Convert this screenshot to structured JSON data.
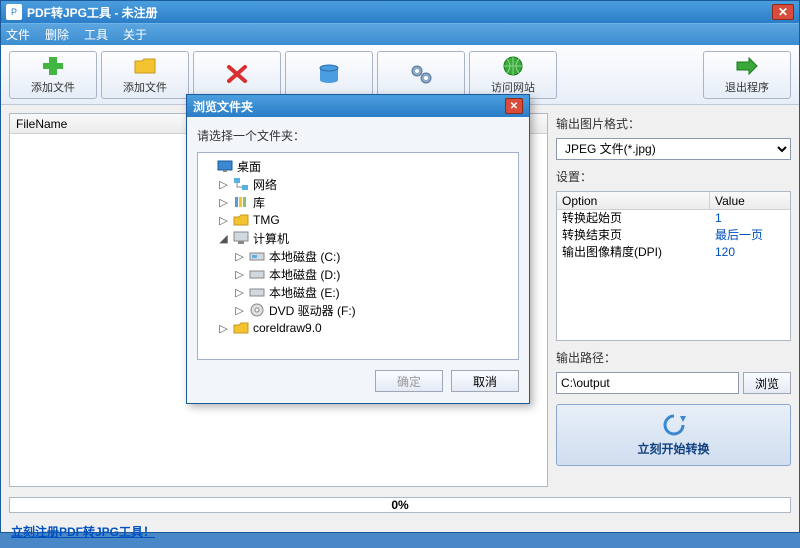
{
  "window": {
    "title": "PDF转JPG工具 - 未注册"
  },
  "menu": {
    "file": "文件",
    "delete": "删除",
    "tools": "工具",
    "about": "关于"
  },
  "toolbar": {
    "add_file": "添加文件",
    "add_folder": "添加文件",
    "delete": "",
    "clear": "",
    "settings": "",
    "visit": "访问网站",
    "exit": "退出程序"
  },
  "file_list": {
    "header": "FileName"
  },
  "right": {
    "format_label": "输出图片格式：",
    "format_value": "JPEG 文件(*.jpg)",
    "settings_label": "设置：",
    "option_header": "Option",
    "value_header": "Value",
    "options": [
      {
        "name": "转换起始页",
        "value": "1"
      },
      {
        "name": "转换结束页",
        "value": "最后一页"
      },
      {
        "name": "输出图像精度(DPI)",
        "value": "120"
      }
    ],
    "path_label": "输出路径：",
    "path_value": "C:\\output",
    "browse": "浏览",
    "convert": "立刻开始转换"
  },
  "progress": {
    "text": "0%"
  },
  "footer": {
    "register_link": "立刻注册PDF转JPG工具！"
  },
  "modal": {
    "title": "浏览文件夹",
    "prompt": "请选择一个文件夹：",
    "ok": "确定",
    "cancel": "取消",
    "tree": {
      "desktop": "桌面",
      "network": "网络",
      "library": "库",
      "tmg": "TMG",
      "computer": "计算机",
      "disk_c": "本地磁盘 (C:)",
      "disk_d": "本地磁盘 (D:)",
      "disk_e": "本地磁盘 (E:)",
      "dvd_f": "DVD 驱动器 (F:)",
      "coreldraw": "coreldraw9.0"
    }
  }
}
